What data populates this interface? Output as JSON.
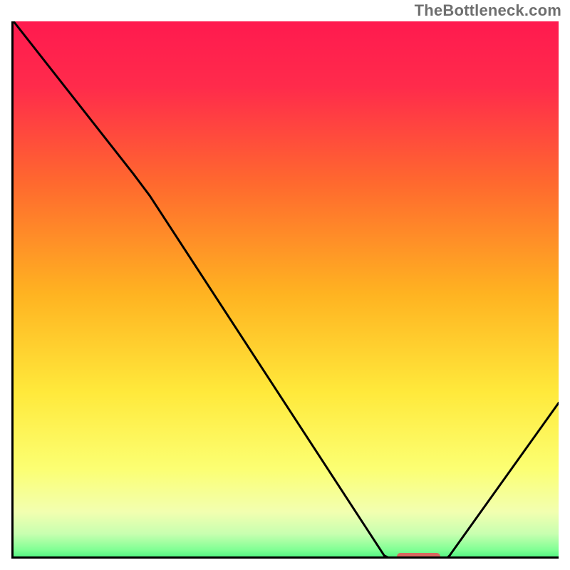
{
  "watermark": "TheBottleneck.com",
  "chart_data": {
    "type": "line",
    "title": "",
    "xlabel": "",
    "ylabel": "",
    "xlim": [
      0,
      100
    ],
    "ylim": [
      0,
      100
    ],
    "x": [
      0,
      22,
      25,
      68,
      72,
      78,
      80,
      100
    ],
    "values": [
      100,
      72,
      68,
      2,
      0,
      0,
      2,
      30
    ],
    "optimum_range_x": [
      70,
      78
    ],
    "gradient_stops": [
      {
        "pos": 0.0,
        "color": "#ff1a4f"
      },
      {
        "pos": 0.12,
        "color": "#ff2b4b"
      },
      {
        "pos": 0.3,
        "color": "#ff6a2e"
      },
      {
        "pos": 0.5,
        "color": "#ffb321"
      },
      {
        "pos": 0.68,
        "color": "#ffe93b"
      },
      {
        "pos": 0.82,
        "color": "#fcff72"
      },
      {
        "pos": 0.9,
        "color": "#f2ffb0"
      },
      {
        "pos": 0.94,
        "color": "#c8ffb0"
      },
      {
        "pos": 0.97,
        "color": "#7fff94"
      },
      {
        "pos": 1.0,
        "color": "#17e86b"
      }
    ],
    "marker_color": "#d9675f"
  }
}
